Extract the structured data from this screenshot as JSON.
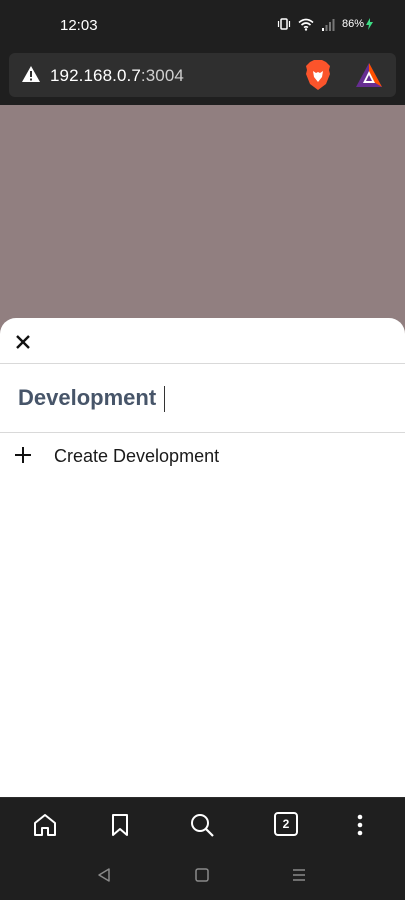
{
  "status_bar": {
    "time": "12:03",
    "battery": "86%"
  },
  "address_bar": {
    "host": "192.168.0.7",
    "port": ":3004"
  },
  "sheet": {
    "query": "Development",
    "create_label": "Create Development"
  },
  "toolbar": {
    "tab_count": "2"
  },
  "icons": {
    "close": "close-icon",
    "plus": "plus-icon",
    "home": "home-icon",
    "bookmark": "bookmark-icon",
    "search": "search-icon",
    "menu": "kebab-menu-icon"
  },
  "colors": {
    "chrome": "#1f1f1f",
    "backdrop": "#917f80",
    "query_text": "#475569",
    "brave_orange": "#fb542b"
  }
}
